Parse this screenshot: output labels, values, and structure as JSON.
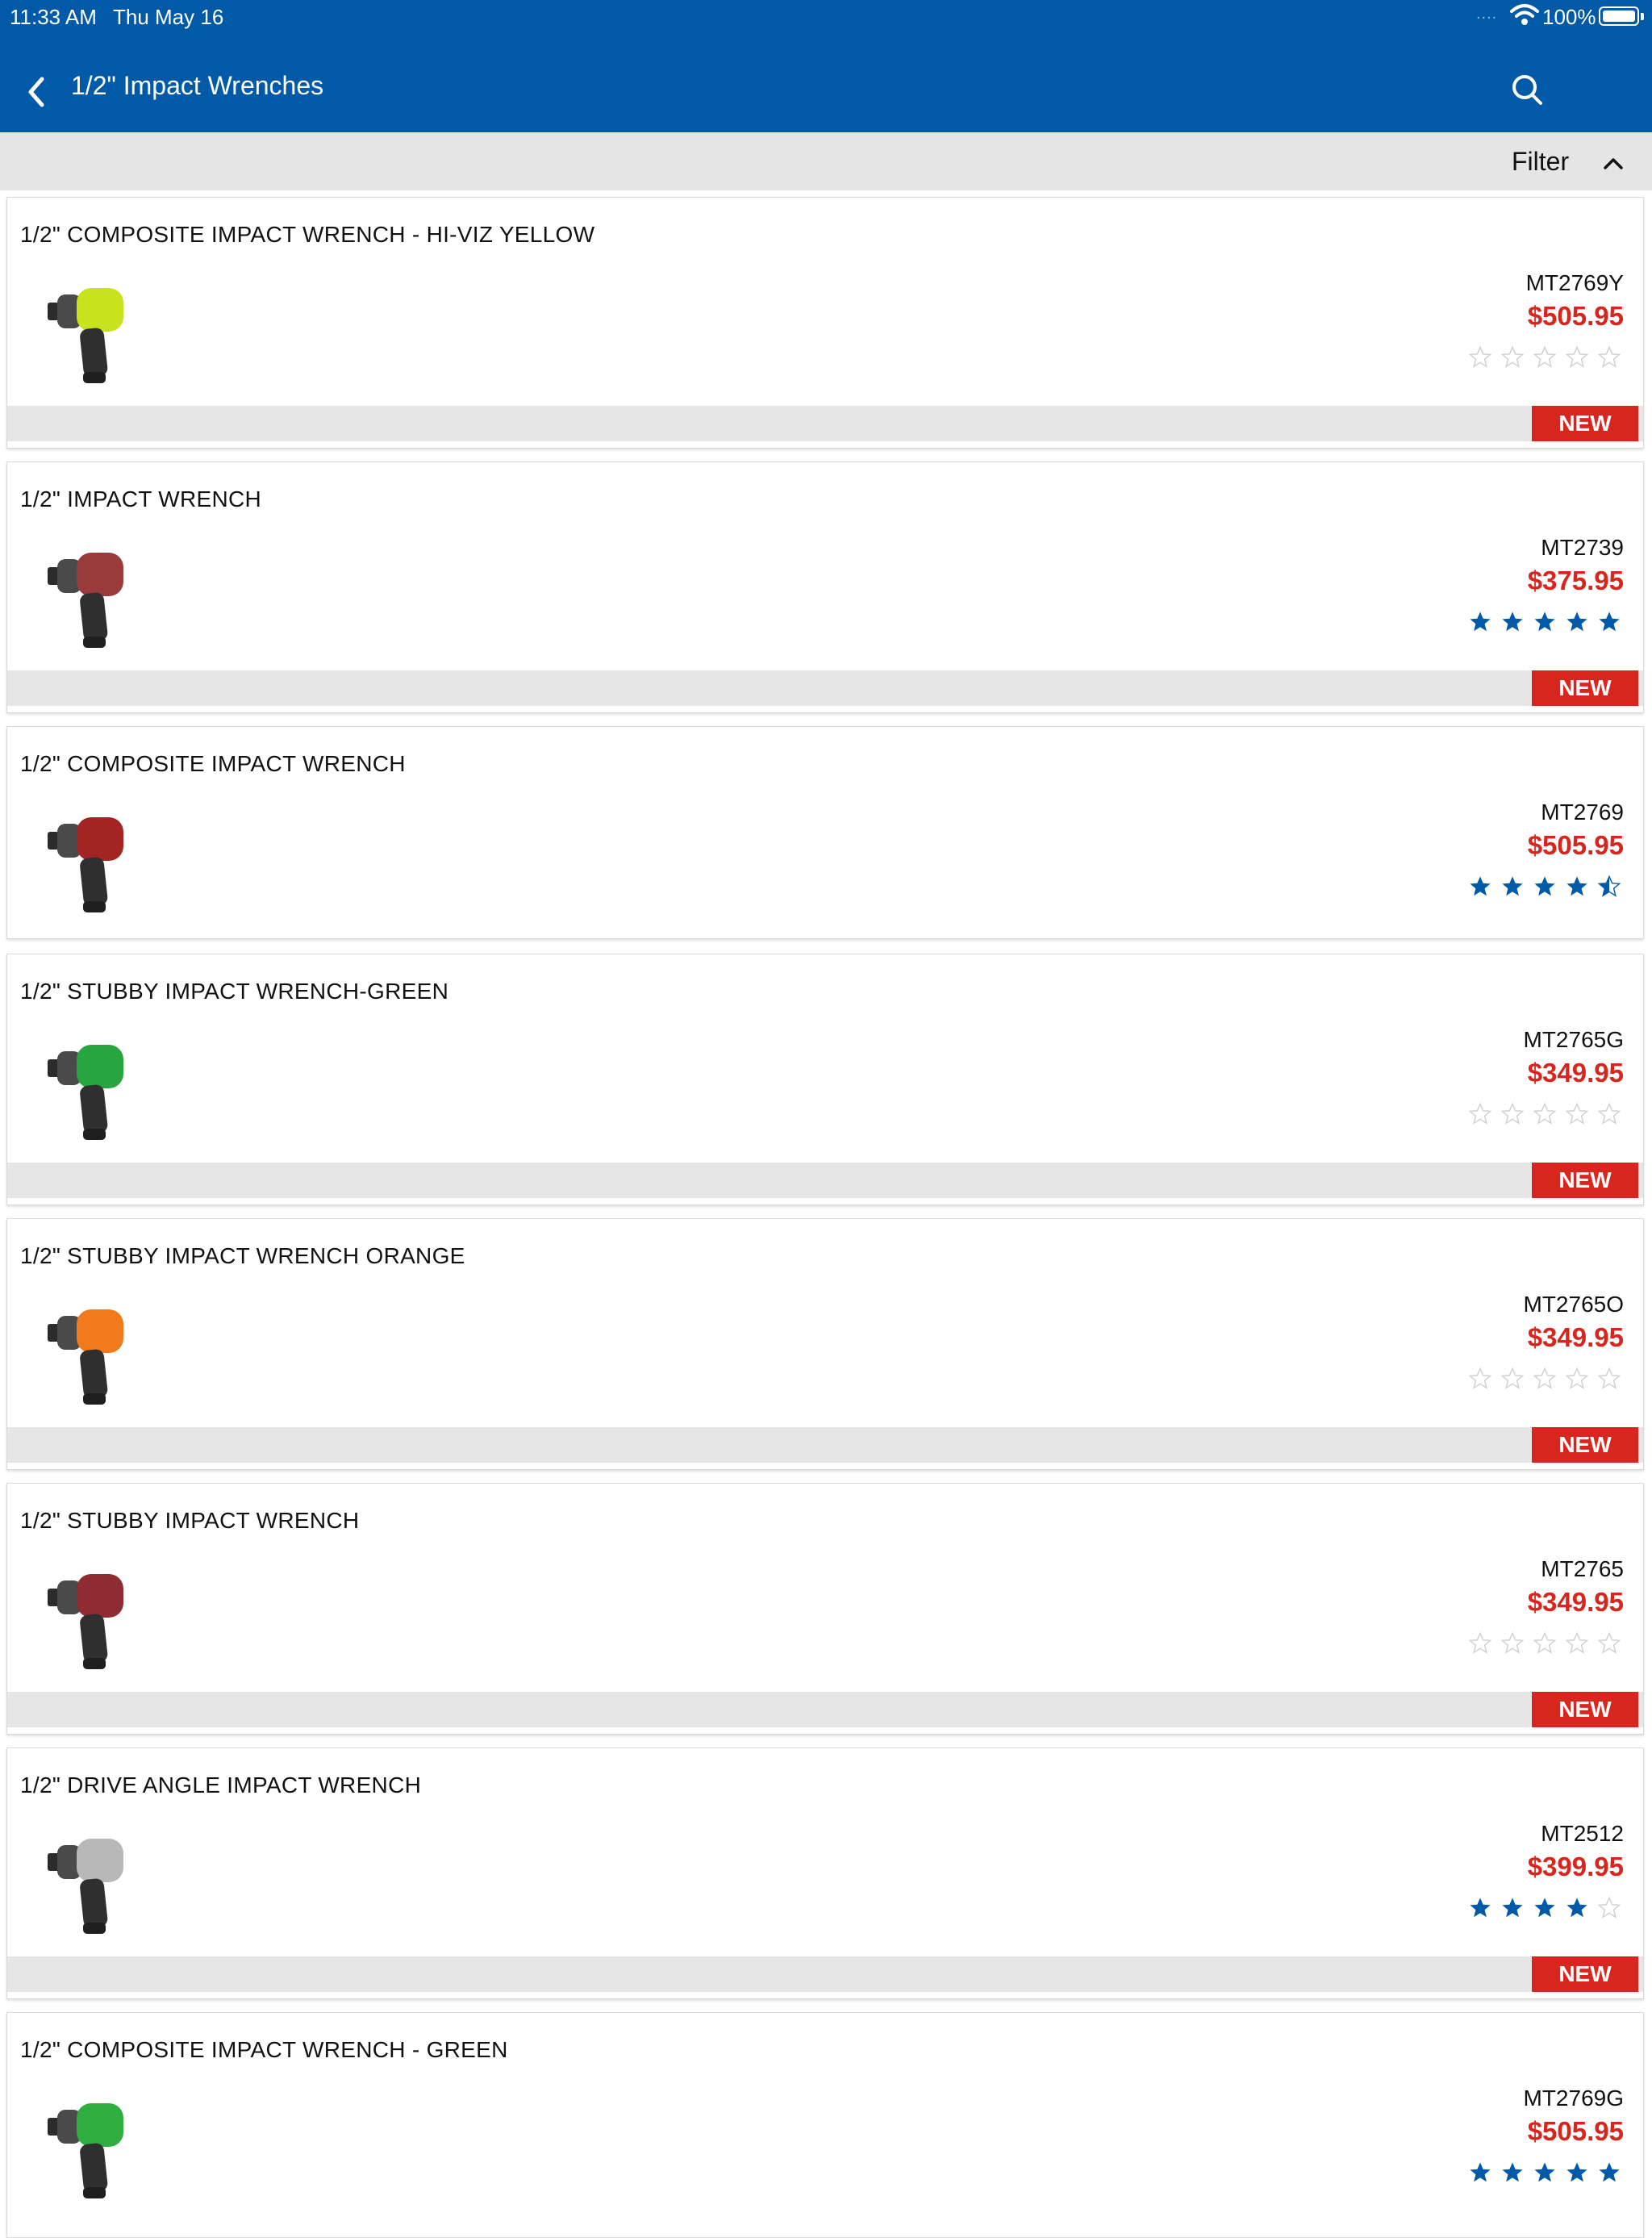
{
  "status": {
    "time": "11:33 AM",
    "date": "Thu May 16",
    "signal": "....",
    "battery": "100%"
  },
  "nav": {
    "title": "1/2\" Impact Wrenches",
    "back_icon": "chevron-left-icon",
    "search_icon": "search-icon"
  },
  "filter": {
    "label": "Filter",
    "icon": "chevron-up-icon"
  },
  "colors": {
    "brand_blue": "#005aa7",
    "price_red": "#d7261e",
    "star_blue": "#005aa7",
    "badge_red": "#d7261e"
  },
  "products": [
    {
      "title": "1/2\" COMPOSITE IMPACT WRENCH - HI-VIZ YELLOW",
      "sku": "MT2769Y",
      "price": "$505.95",
      "rating": 0,
      "badge": "NEW",
      "image_color": "#c8e21c"
    },
    {
      "title": "1/2\" IMPACT WRENCH",
      "sku": "MT2739",
      "price": "$375.95",
      "rating": 5,
      "badge": "NEW",
      "image_color": "#9a3b3b"
    },
    {
      "title": "1/2\" COMPOSITE IMPACT WRENCH",
      "sku": "MT2769",
      "price": "$505.95",
      "rating": 4.5,
      "badge": "",
      "image_color": "#a42424"
    },
    {
      "title": "1/2\" STUBBY IMPACT WRENCH-GREEN",
      "sku": "MT2765G",
      "price": "$349.95",
      "rating": 0,
      "badge": "NEW",
      "image_color": "#27a53e"
    },
    {
      "title": "1/2\" STUBBY IMPACT WRENCH ORANGE",
      "sku": "MT2765O",
      "price": "$349.95",
      "rating": 0,
      "badge": "NEW",
      "image_color": "#f07a1c"
    },
    {
      "title": "1/2\" STUBBY IMPACT WRENCH",
      "sku": "MT2765",
      "price": "$349.95",
      "rating": 0,
      "badge": "NEW",
      "image_color": "#8e2b33"
    },
    {
      "title": "1/2\" DRIVE ANGLE IMPACT WRENCH",
      "sku": "MT2512",
      "price": "$399.95",
      "rating": 4,
      "badge": "NEW",
      "image_color": "#b8b8b8"
    },
    {
      "title": "1/2\" COMPOSITE IMPACT WRENCH - GREEN",
      "sku": "MT2769G",
      "price": "$505.95",
      "rating": 5,
      "badge": "",
      "image_color": "#2fae3f"
    }
  ]
}
